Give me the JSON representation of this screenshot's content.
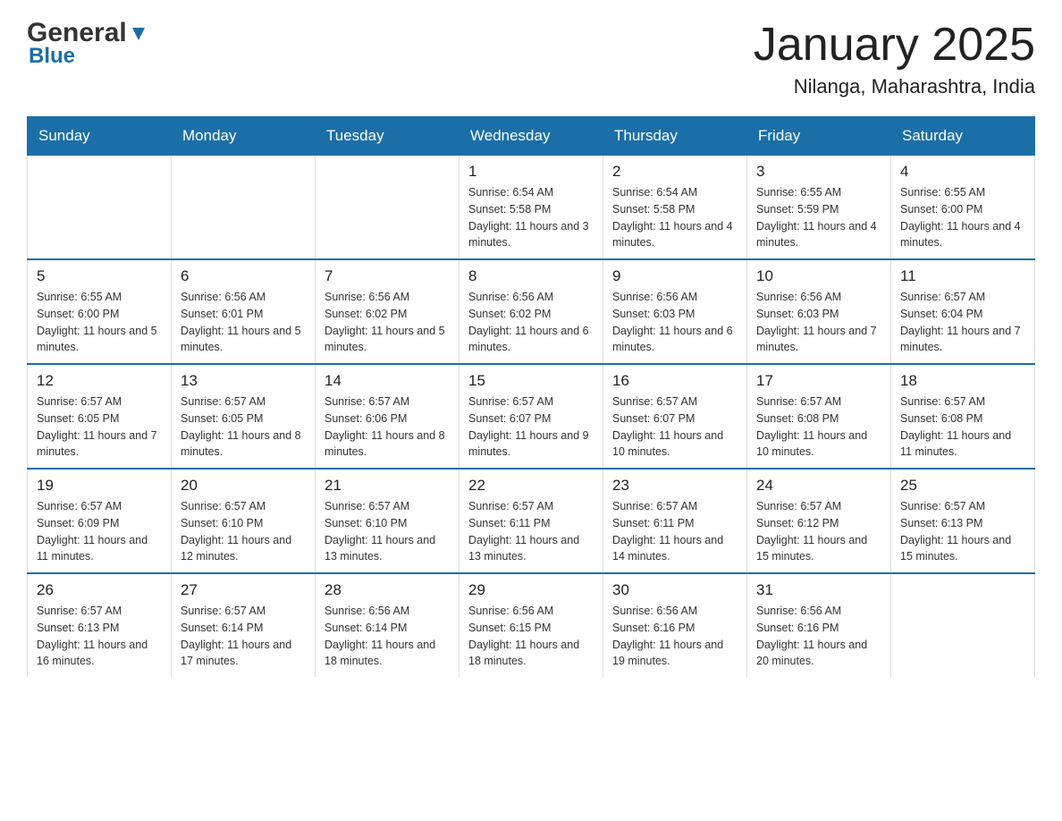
{
  "header": {
    "logo_general": "General",
    "logo_blue": "Blue",
    "month_title": "January 2025",
    "location": "Nilanga, Maharashtra, India"
  },
  "days_of_week": [
    "Sunday",
    "Monday",
    "Tuesday",
    "Wednesday",
    "Thursday",
    "Friday",
    "Saturday"
  ],
  "weeks": [
    [
      {
        "day": "",
        "info": ""
      },
      {
        "day": "",
        "info": ""
      },
      {
        "day": "",
        "info": ""
      },
      {
        "day": "1",
        "info": "Sunrise: 6:54 AM\nSunset: 5:58 PM\nDaylight: 11 hours and 3 minutes."
      },
      {
        "day": "2",
        "info": "Sunrise: 6:54 AM\nSunset: 5:58 PM\nDaylight: 11 hours and 4 minutes."
      },
      {
        "day": "3",
        "info": "Sunrise: 6:55 AM\nSunset: 5:59 PM\nDaylight: 11 hours and 4 minutes."
      },
      {
        "day": "4",
        "info": "Sunrise: 6:55 AM\nSunset: 6:00 PM\nDaylight: 11 hours and 4 minutes."
      }
    ],
    [
      {
        "day": "5",
        "info": "Sunrise: 6:55 AM\nSunset: 6:00 PM\nDaylight: 11 hours and 5 minutes."
      },
      {
        "day": "6",
        "info": "Sunrise: 6:56 AM\nSunset: 6:01 PM\nDaylight: 11 hours and 5 minutes."
      },
      {
        "day": "7",
        "info": "Sunrise: 6:56 AM\nSunset: 6:02 PM\nDaylight: 11 hours and 5 minutes."
      },
      {
        "day": "8",
        "info": "Sunrise: 6:56 AM\nSunset: 6:02 PM\nDaylight: 11 hours and 6 minutes."
      },
      {
        "day": "9",
        "info": "Sunrise: 6:56 AM\nSunset: 6:03 PM\nDaylight: 11 hours and 6 minutes."
      },
      {
        "day": "10",
        "info": "Sunrise: 6:56 AM\nSunset: 6:03 PM\nDaylight: 11 hours and 7 minutes."
      },
      {
        "day": "11",
        "info": "Sunrise: 6:57 AM\nSunset: 6:04 PM\nDaylight: 11 hours and 7 minutes."
      }
    ],
    [
      {
        "day": "12",
        "info": "Sunrise: 6:57 AM\nSunset: 6:05 PM\nDaylight: 11 hours and 7 minutes."
      },
      {
        "day": "13",
        "info": "Sunrise: 6:57 AM\nSunset: 6:05 PM\nDaylight: 11 hours and 8 minutes."
      },
      {
        "day": "14",
        "info": "Sunrise: 6:57 AM\nSunset: 6:06 PM\nDaylight: 11 hours and 8 minutes."
      },
      {
        "day": "15",
        "info": "Sunrise: 6:57 AM\nSunset: 6:07 PM\nDaylight: 11 hours and 9 minutes."
      },
      {
        "day": "16",
        "info": "Sunrise: 6:57 AM\nSunset: 6:07 PM\nDaylight: 11 hours and 10 minutes."
      },
      {
        "day": "17",
        "info": "Sunrise: 6:57 AM\nSunset: 6:08 PM\nDaylight: 11 hours and 10 minutes."
      },
      {
        "day": "18",
        "info": "Sunrise: 6:57 AM\nSunset: 6:08 PM\nDaylight: 11 hours and 11 minutes."
      }
    ],
    [
      {
        "day": "19",
        "info": "Sunrise: 6:57 AM\nSunset: 6:09 PM\nDaylight: 11 hours and 11 minutes."
      },
      {
        "day": "20",
        "info": "Sunrise: 6:57 AM\nSunset: 6:10 PM\nDaylight: 11 hours and 12 minutes."
      },
      {
        "day": "21",
        "info": "Sunrise: 6:57 AM\nSunset: 6:10 PM\nDaylight: 11 hours and 13 minutes."
      },
      {
        "day": "22",
        "info": "Sunrise: 6:57 AM\nSunset: 6:11 PM\nDaylight: 11 hours and 13 minutes."
      },
      {
        "day": "23",
        "info": "Sunrise: 6:57 AM\nSunset: 6:11 PM\nDaylight: 11 hours and 14 minutes."
      },
      {
        "day": "24",
        "info": "Sunrise: 6:57 AM\nSunset: 6:12 PM\nDaylight: 11 hours and 15 minutes."
      },
      {
        "day": "25",
        "info": "Sunrise: 6:57 AM\nSunset: 6:13 PM\nDaylight: 11 hours and 15 minutes."
      }
    ],
    [
      {
        "day": "26",
        "info": "Sunrise: 6:57 AM\nSunset: 6:13 PM\nDaylight: 11 hours and 16 minutes."
      },
      {
        "day": "27",
        "info": "Sunrise: 6:57 AM\nSunset: 6:14 PM\nDaylight: 11 hours and 17 minutes."
      },
      {
        "day": "28",
        "info": "Sunrise: 6:56 AM\nSunset: 6:14 PM\nDaylight: 11 hours and 18 minutes."
      },
      {
        "day": "29",
        "info": "Sunrise: 6:56 AM\nSunset: 6:15 PM\nDaylight: 11 hours and 18 minutes."
      },
      {
        "day": "30",
        "info": "Sunrise: 6:56 AM\nSunset: 6:16 PM\nDaylight: 11 hours and 19 minutes."
      },
      {
        "day": "31",
        "info": "Sunrise: 6:56 AM\nSunset: 6:16 PM\nDaylight: 11 hours and 20 minutes."
      },
      {
        "day": "",
        "info": ""
      }
    ]
  ]
}
